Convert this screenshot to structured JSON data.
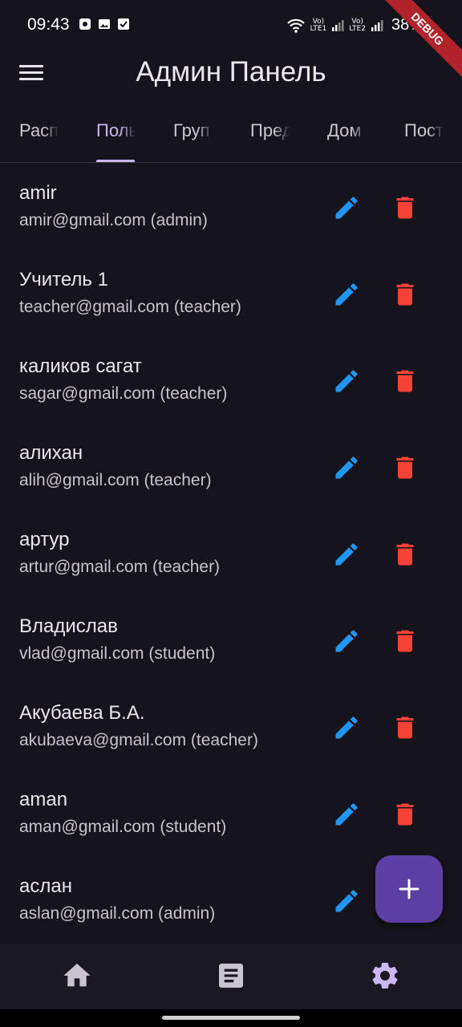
{
  "status_bar": {
    "time": "09:43",
    "sim1_top": "Vo)",
    "sim1_bottom": "LTE1",
    "sim2_top": "Vo)",
    "sim2_bottom": "LTE2",
    "battery": "38%"
  },
  "debug_banner": "DEBUG",
  "app_bar": {
    "title": "Админ Панель"
  },
  "tabs": [
    "Расп",
    "Поль",
    "Груп",
    "Пред",
    "Дом",
    "Пост"
  ],
  "active_tab_index": 1,
  "users": [
    {
      "name": "amir",
      "subtitle": "amir@gmail.com (admin)"
    },
    {
      "name": "Учитель 1",
      "subtitle": "teacher@gmail.com (teacher)"
    },
    {
      "name": "каликов сагат",
      "subtitle": "sagar@gmail.com (teacher)"
    },
    {
      "name": "алихан",
      "subtitle": "alih@gmail.com (teacher)"
    },
    {
      "name": "артур",
      "subtitle": "artur@gmail.com (teacher)"
    },
    {
      "name": "Владислав",
      "subtitle": "vlad@gmail.com (student)"
    },
    {
      "name": "Акубаева Б.А.",
      "subtitle": "akubaeva@gmail.com (teacher)"
    },
    {
      "name": "aman",
      "subtitle": "aman@gmail.com (student)"
    },
    {
      "name": "аслан",
      "subtitle": "aslan@gmail.com (admin)"
    }
  ],
  "icons": {
    "menu": "menu-icon",
    "edit": "pencil-icon",
    "delete": "trash-icon",
    "fab": "plus-icon",
    "nav": [
      "home-icon",
      "article-icon",
      "gear-icon"
    ]
  },
  "colors": {
    "background": "#15131b",
    "accent": "#c9b8f5",
    "edit": "#2196f3",
    "delete": "#f44336",
    "fab": "#5b3fa3",
    "debug": "#b0232b"
  }
}
